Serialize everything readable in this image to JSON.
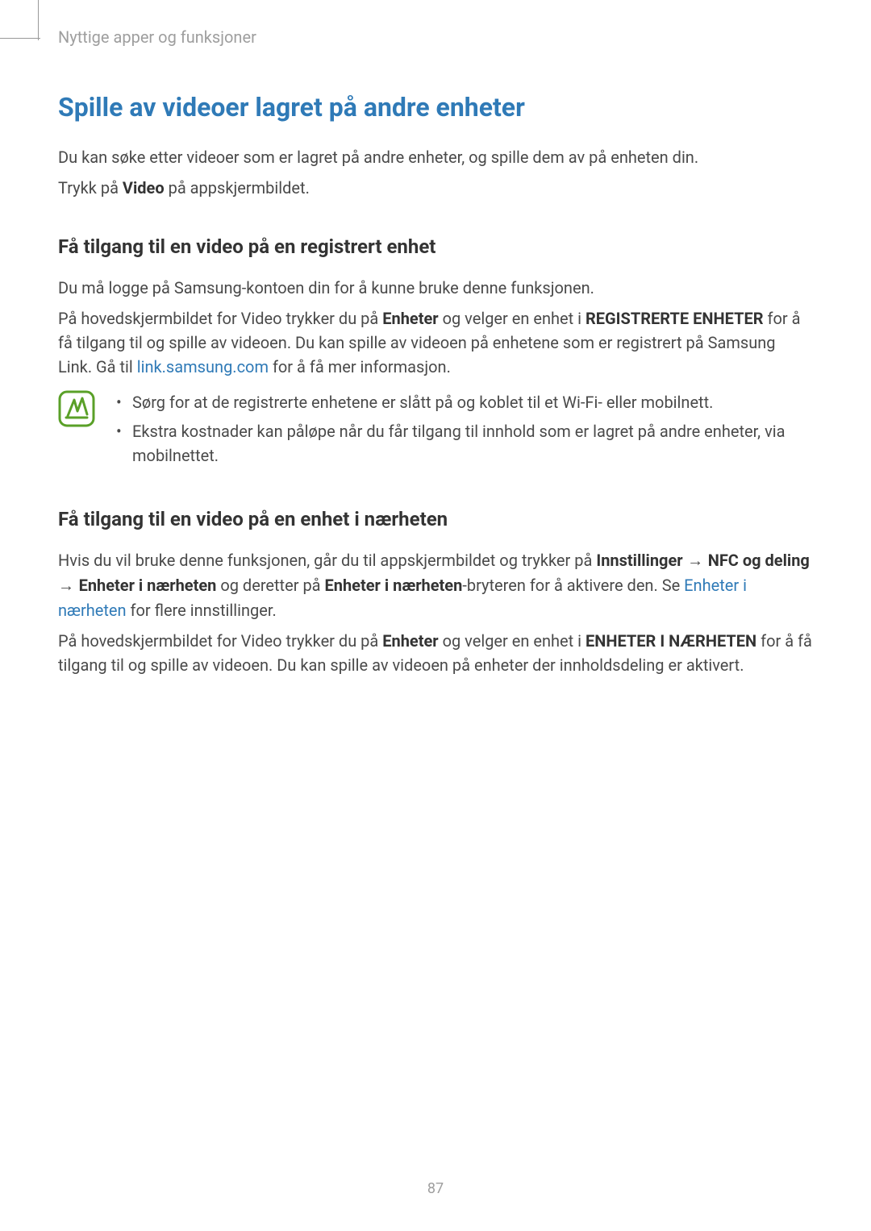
{
  "breadcrumb": "Nyttige apper og funksjoner",
  "heading1": "Spille av videoer lagret på andre enheter",
  "intro1": "Du kan søke etter videoer som er lagret på andre enheter, og spille dem av på enheten din.",
  "intro2_pre": "Trykk på ",
  "intro2_bold": "Video",
  "intro2_post": " på appskjermbildet.",
  "section1": {
    "heading": "Få tilgang til en video på en registrert enhet",
    "p1": "Du må logge på Samsung-kontoen din for å kunne bruke denne funksjonen.",
    "p2_pre": "På hovedskjermbildet for Video trykker du på ",
    "p2_bold1": "Enheter",
    "p2_mid1": " og velger en enhet i ",
    "p2_bold2": "REGISTRERTE ENHETER",
    "p2_mid2": " for å få tilgang til og spille av videoen. Du kan spille av videoen på enhetene som er registrert på Samsung Link. Gå til ",
    "p2_link": "link.samsung.com",
    "p2_post": " for å få mer informasjon.",
    "note1": "Sørg for at de registrerte enhetene er slått på og koblet til et Wi-Fi- eller mobilnett.",
    "note2": "Ekstra kostnader kan påløpe når du får tilgang til innhold som er lagret på andre enheter, via mobilnettet."
  },
  "section2": {
    "heading": "Få tilgang til en video på en enhet i nærheten",
    "p1_pre": "Hvis du vil bruke denne funksjonen, går du til appskjermbildet og trykker på ",
    "p1_bold1": "Innstillinger",
    "p1_arrow1": " → ",
    "p1_bold2": "NFC og deling",
    "p1_arrow2": " → ",
    "p1_bold3": "Enheter i nærheten",
    "p1_mid1": " og deretter på ",
    "p1_bold4": "Enheter i nærheten",
    "p1_mid2": "-bryteren for å aktivere den. Se ",
    "p1_link": "Enheter i nærheten",
    "p1_post": " for flere innstillinger.",
    "p2_pre": "På hovedskjermbildet for Video trykker du på ",
    "p2_bold1": "Enheter",
    "p2_mid1": " og velger en enhet i ",
    "p2_bold2": "ENHETER I NÆRHETEN",
    "p2_post": " for å få tilgang til og spille av videoen. Du kan spille av videoen på enheter der innholdsdeling er aktivert."
  },
  "page_number": "87"
}
